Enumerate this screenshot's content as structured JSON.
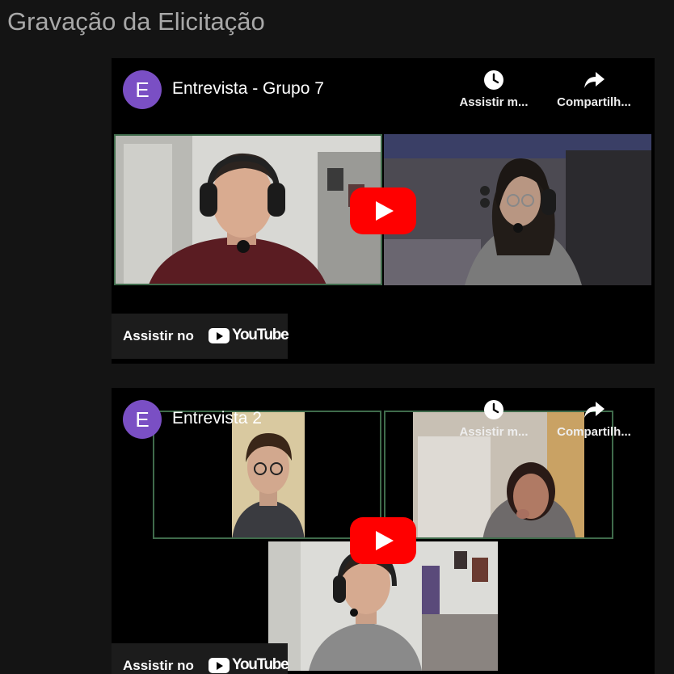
{
  "page": {
    "title": "Gravação da Elicitação"
  },
  "videos": [
    {
      "channel_initial": "E",
      "title": "Entrevista - Grupo 7",
      "watch_later_label": "Assistir m...",
      "share_label": "Compartilh...",
      "watch_on_label": "Assistir no",
      "youtube_label": "YouTube"
    },
    {
      "channel_initial": "E",
      "title": "Entrevista 2",
      "watch_later_label": "Assistir m...",
      "share_label": "Compartilh...",
      "watch_on_label": "Assistir no",
      "youtube_label": "YouTube"
    }
  ],
  "icons": {
    "avatar": "channel-avatar",
    "watch_later": "clock-icon",
    "share": "share-arrow-icon",
    "play": "play-icon",
    "youtube": "youtube-logo-icon"
  },
  "colors": {
    "background": "#141414",
    "avatar": "#7a4fc4",
    "youtube_red": "#ff0000",
    "speaker_frame": "#3f6b4b"
  }
}
